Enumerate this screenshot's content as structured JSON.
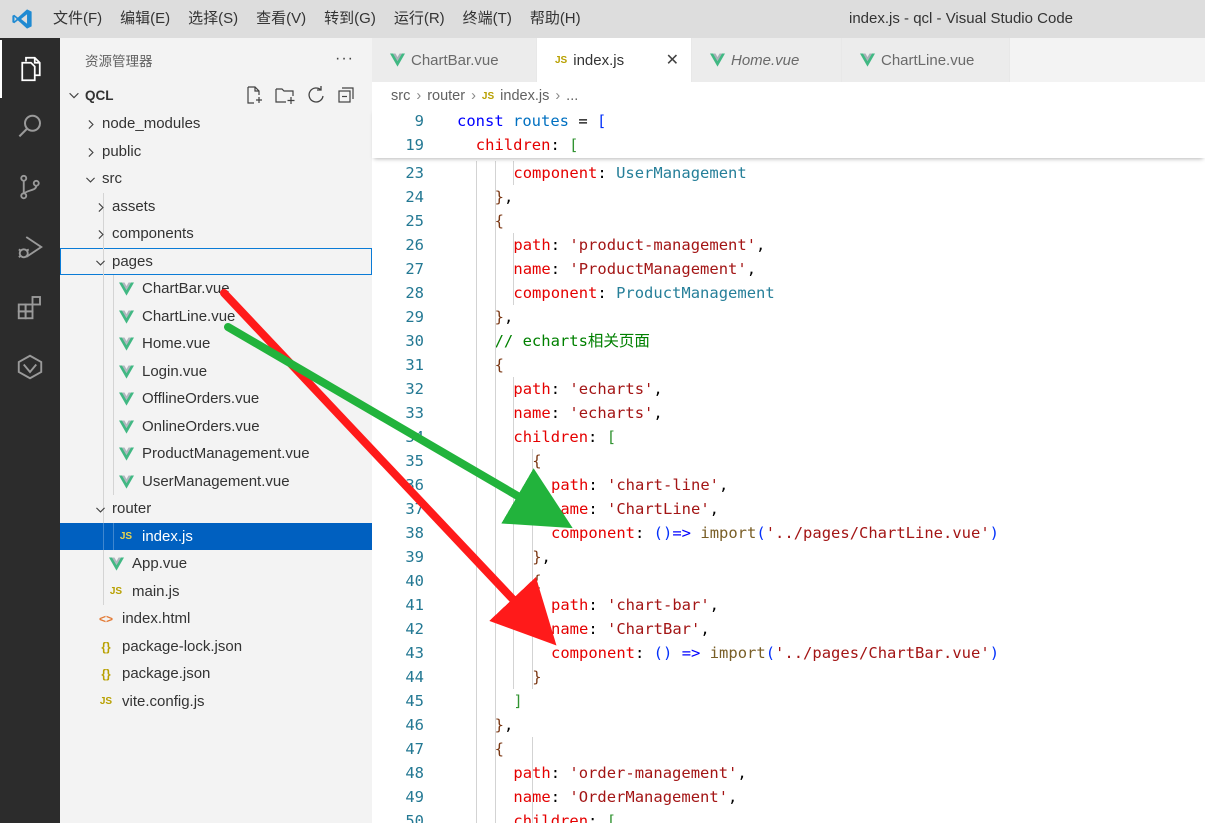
{
  "window": {
    "title": "index.js - qcl - Visual Studio Code"
  },
  "menu": [
    "文件(F)",
    "编辑(E)",
    "选择(S)",
    "查看(V)",
    "转到(G)",
    "运行(R)",
    "终端(T)",
    "帮助(H)"
  ],
  "activity_bar": [
    {
      "icon": "explorer-icon",
      "active": true
    },
    {
      "icon": "search-icon",
      "active": false
    },
    {
      "icon": "source-control-icon",
      "active": false
    },
    {
      "icon": "run-debug-icon",
      "active": false
    },
    {
      "icon": "extensions-icon",
      "active": false
    },
    {
      "icon": "remote-explorer-icon",
      "active": false
    }
  ],
  "sidebar": {
    "title": "资源管理器",
    "more": "···",
    "root": "QCL",
    "tree": [
      {
        "label": "node_modules",
        "type": "folder",
        "depth": 1,
        "expanded": false
      },
      {
        "label": "public",
        "type": "folder",
        "depth": 1,
        "expanded": false
      },
      {
        "label": "src",
        "type": "folder",
        "depth": 1,
        "expanded": true
      },
      {
        "label": "assets",
        "type": "folder",
        "depth": 2,
        "expanded": false
      },
      {
        "label": "components",
        "type": "folder",
        "depth": 2,
        "expanded": false
      },
      {
        "label": "pages",
        "type": "folder",
        "depth": 2,
        "expanded": true,
        "focused": true
      },
      {
        "label": "ChartBar.vue",
        "type": "vue",
        "depth": 3
      },
      {
        "label": "ChartLine.vue",
        "type": "vue",
        "depth": 3
      },
      {
        "label": "Home.vue",
        "type": "vue",
        "depth": 3
      },
      {
        "label": "Login.vue",
        "type": "vue",
        "depth": 3
      },
      {
        "label": "OfflineOrders.vue",
        "type": "vue",
        "depth": 3
      },
      {
        "label": "OnlineOrders.vue",
        "type": "vue",
        "depth": 3
      },
      {
        "label": "ProductManagement.vue",
        "type": "vue",
        "depth": 3
      },
      {
        "label": "UserManagement.vue",
        "type": "vue",
        "depth": 3
      },
      {
        "label": "router",
        "type": "folder",
        "depth": 2,
        "expanded": true
      },
      {
        "label": "index.js",
        "type": "js",
        "depth": 3,
        "selected": true
      },
      {
        "label": "App.vue",
        "type": "vue",
        "depth": 2
      },
      {
        "label": "main.js",
        "type": "js",
        "depth": 2
      },
      {
        "label": "index.html",
        "type": "html",
        "depth": 1
      },
      {
        "label": "package-lock.json",
        "type": "json",
        "depth": 1
      },
      {
        "label": "package.json",
        "type": "json",
        "depth": 1
      },
      {
        "label": "vite.config.js",
        "type": "js",
        "depth": 1
      }
    ]
  },
  "tabs": [
    {
      "label": "ChartBar.vue",
      "type": "vue",
      "active": false,
      "italic": false
    },
    {
      "label": "index.js",
      "type": "js",
      "active": true,
      "italic": false,
      "close": "✕"
    },
    {
      "label": "Home.vue",
      "type": "vue",
      "active": false,
      "italic": true
    },
    {
      "label": "ChartLine.vue",
      "type": "vue",
      "active": false,
      "italic": false
    }
  ],
  "breadcrumb": [
    "src",
    "router",
    "index.js",
    "..."
  ],
  "file_badges": {
    "js": "JS",
    "json": "{}",
    "html": "<>"
  },
  "sticky_lines": [
    {
      "num": "9",
      "indent": 0,
      "tokens": [
        [
          "k",
          "const "
        ],
        [
          "v",
          "routes"
        ],
        [
          "o",
          " = "
        ],
        [
          "b1",
          "["
        ]
      ]
    },
    {
      "num": "19",
      "indent": 1,
      "tokens": [
        [
          "p",
          "children"
        ],
        [
          "o",
          ": "
        ],
        [
          "b2",
          "["
        ]
      ]
    }
  ],
  "code_lines": [
    {
      "num": "23",
      "indent": 3,
      "tokens": [
        [
          "p",
          "component"
        ],
        [
          "o",
          ": "
        ],
        [
          "t",
          "UserManagement"
        ]
      ]
    },
    {
      "num": "24",
      "indent": 2,
      "tokens": [
        [
          "b3",
          "}"
        ],
        [
          "o",
          ","
        ]
      ]
    },
    {
      "num": "25",
      "indent": 2,
      "tokens": [
        [
          "b3",
          "{"
        ]
      ]
    },
    {
      "num": "26",
      "indent": 3,
      "tokens": [
        [
          "p",
          "path"
        ],
        [
          "o",
          ": "
        ],
        [
          "s",
          "'product-management'"
        ],
        [
          "o",
          ","
        ]
      ]
    },
    {
      "num": "27",
      "indent": 3,
      "tokens": [
        [
          "p",
          "name"
        ],
        [
          "o",
          ": "
        ],
        [
          "s",
          "'ProductManagement'"
        ],
        [
          "o",
          ","
        ]
      ]
    },
    {
      "num": "28",
      "indent": 3,
      "tokens": [
        [
          "p",
          "component"
        ],
        [
          "o",
          ": "
        ],
        [
          "t",
          "ProductManagement"
        ]
      ]
    },
    {
      "num": "29",
      "indent": 2,
      "tokens": [
        [
          "b3",
          "}"
        ],
        [
          "o",
          ","
        ]
      ]
    },
    {
      "num": "30",
      "indent": 2,
      "tokens": [
        [
          "c",
          "// echarts相关页面"
        ]
      ]
    },
    {
      "num": "31",
      "indent": 2,
      "tokens": [
        [
          "b3",
          "{"
        ]
      ]
    },
    {
      "num": "32",
      "indent": 3,
      "tokens": [
        [
          "p",
          "path"
        ],
        [
          "o",
          ": "
        ],
        [
          "s",
          "'echarts'"
        ],
        [
          "o",
          ","
        ]
      ]
    },
    {
      "num": "33",
      "indent": 3,
      "tokens": [
        [
          "p",
          "name"
        ],
        [
          "o",
          ": "
        ],
        [
          "s",
          "'echarts'"
        ],
        [
          "o",
          ","
        ]
      ]
    },
    {
      "num": "34",
      "indent": 3,
      "tokens": [
        [
          "p",
          "children"
        ],
        [
          "o",
          ": "
        ],
        [
          "b2",
          "["
        ]
      ]
    },
    {
      "num": "35",
      "indent": 4,
      "tokens": [
        [
          "b3",
          "{"
        ]
      ]
    },
    {
      "num": "36",
      "indent": 5,
      "tokens": [
        [
          "p",
          "path"
        ],
        [
          "o",
          ": "
        ],
        [
          "s",
          "'chart-line'"
        ],
        [
          "o",
          ","
        ]
      ]
    },
    {
      "num": "37",
      "indent": 5,
      "tokens": [
        [
          "p",
          "name"
        ],
        [
          "o",
          ": "
        ],
        [
          "s",
          "'ChartLine'"
        ],
        [
          "o",
          ","
        ]
      ]
    },
    {
      "num": "38",
      "indent": 5,
      "tokens": [
        [
          "p",
          "component"
        ],
        [
          "o",
          ": "
        ],
        [
          "b1",
          "()"
        ],
        [
          "k",
          "=>"
        ],
        [
          "o",
          " "
        ],
        [
          "f",
          "import"
        ],
        [
          "b1",
          "("
        ],
        [
          "s",
          "'../pages/ChartLine.vue'"
        ],
        [
          "b1",
          ")"
        ]
      ]
    },
    {
      "num": "39",
      "indent": 4,
      "tokens": [
        [
          "b3",
          "}"
        ],
        [
          "o",
          ","
        ]
      ]
    },
    {
      "num": "40",
      "indent": 4,
      "tokens": [
        [
          "b3",
          "{"
        ]
      ]
    },
    {
      "num": "41",
      "indent": 5,
      "tokens": [
        [
          "p",
          "path"
        ],
        [
          "o",
          ": "
        ],
        [
          "s",
          "'chart-bar'"
        ],
        [
          "o",
          ","
        ]
      ]
    },
    {
      "num": "42",
      "indent": 5,
      "tokens": [
        [
          "p",
          "name"
        ],
        [
          "o",
          ": "
        ],
        [
          "s",
          "'ChartBar'"
        ],
        [
          "o",
          ","
        ]
      ]
    },
    {
      "num": "43",
      "indent": 5,
      "tokens": [
        [
          "p",
          "component"
        ],
        [
          "o",
          ": "
        ],
        [
          "b1",
          "()"
        ],
        [
          "o",
          " "
        ],
        [
          "k",
          "=>"
        ],
        [
          "o",
          " "
        ],
        [
          "f",
          "import"
        ],
        [
          "b1",
          "("
        ],
        [
          "s",
          "'../pages/ChartBar.vue'"
        ],
        [
          "b1",
          ")"
        ]
      ]
    },
    {
      "num": "44",
      "indent": 4,
      "tokens": [
        [
          "b3",
          "}"
        ]
      ]
    },
    {
      "num": "45",
      "indent": 3,
      "tokens": [
        [
          "b2",
          "]"
        ]
      ]
    },
    {
      "num": "46",
      "indent": 2,
      "tokens": [
        [
          "b3",
          "}"
        ],
        [
          "o",
          ","
        ]
      ]
    },
    {
      "num": "47",
      "indent": 2,
      "tokens": [
        [
          "b3",
          "{"
        ]
      ]
    },
    {
      "num": "48",
      "indent": 3,
      "tokens": [
        [
          "p",
          "path"
        ],
        [
          "o",
          ": "
        ],
        [
          "s",
          "'order-management'"
        ],
        [
          "o",
          ","
        ]
      ]
    },
    {
      "num": "49",
      "indent": 3,
      "tokens": [
        [
          "p",
          "name"
        ],
        [
          "o",
          ": "
        ],
        [
          "s",
          "'OrderManagement'"
        ],
        [
          "o",
          ","
        ]
      ]
    },
    {
      "num": "50",
      "indent": 3,
      "tokens": [
        [
          "p",
          "children"
        ],
        [
          "o",
          ": "
        ],
        [
          "b2",
          "["
        ]
      ]
    }
  ],
  "annotations": {
    "red_arrow": {
      "from": "ChartBar.vue",
      "to_line": "43",
      "color": "#ff1a1a"
    },
    "green_arrow": {
      "from": "ChartLine.vue",
      "to_line": "38",
      "color": "#22b33c"
    }
  }
}
